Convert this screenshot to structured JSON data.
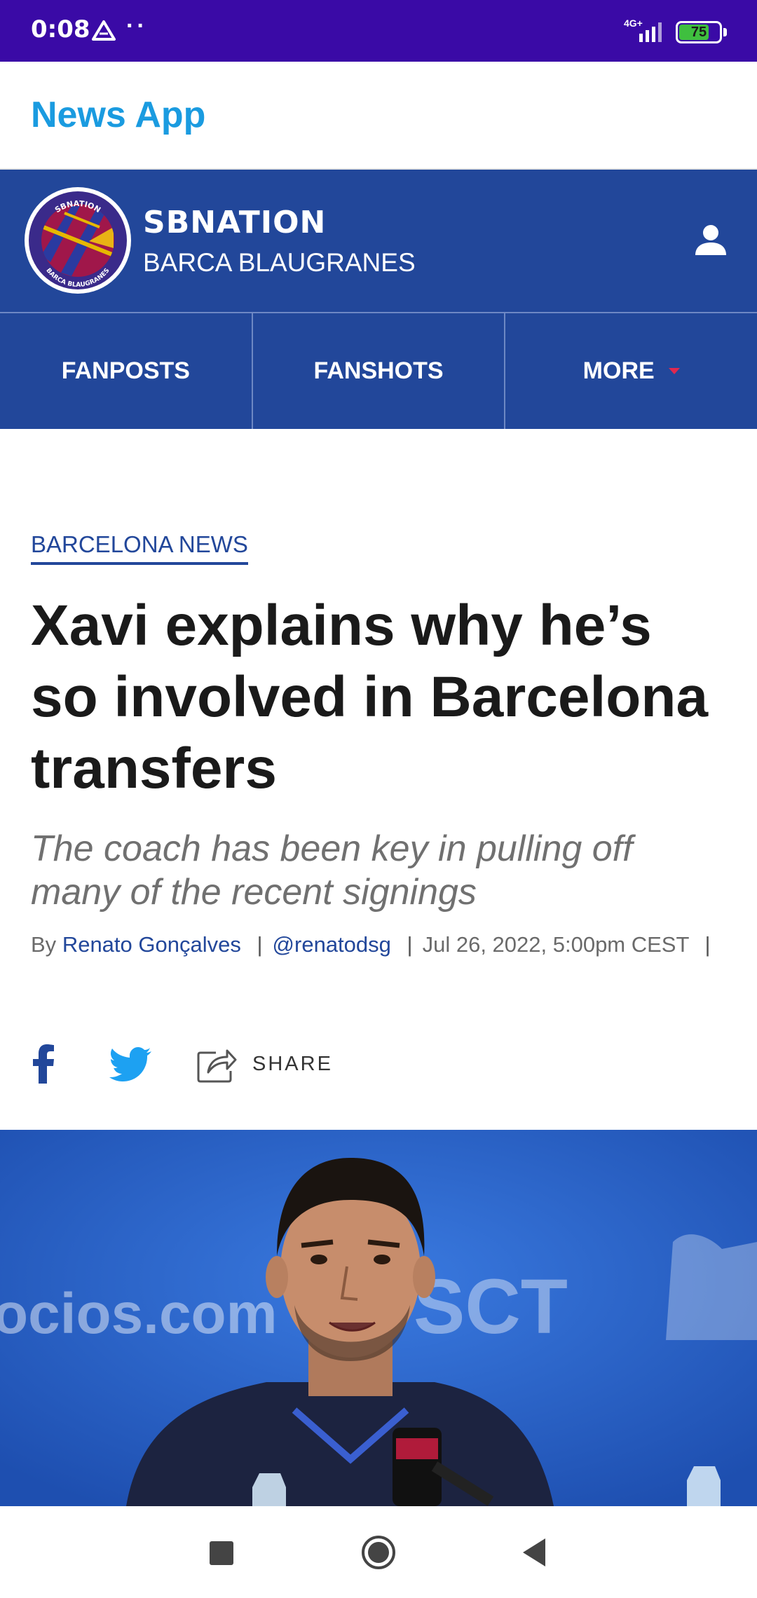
{
  "status_bar": {
    "time": "0:08",
    "network": "4G+",
    "battery": "75",
    "battery_level_percent": 75
  },
  "app_bar": {
    "title": "News App"
  },
  "site_header": {
    "brand": "SBNATION",
    "subbrand": "BARCA BLAUGRANES",
    "logo_text_top": "SBNATION",
    "logo_text_bottom": "BARCA BLAUGRANES"
  },
  "nav": {
    "items": [
      {
        "label": "FANPOSTS"
      },
      {
        "label": "FANSHOTS"
      },
      {
        "label": "MORE"
      }
    ]
  },
  "article": {
    "category": "BARCELONA NEWS",
    "headline": "Xavi explains why he’s so involved in Barcelona transfers",
    "dek": "The coach has been key in pulling off many of the recent signings",
    "byline_prefix": "By",
    "author": "Renato Gonçalves",
    "handle": "@renatodsg",
    "date": "Jul 26, 2022, 5:00pm CEST",
    "separator": "|"
  },
  "share": {
    "label": "SHARE"
  },
  "hero": {
    "background_text_left": "ocios.com",
    "background_text_mid": "SCT"
  },
  "colors": {
    "status_bar": "#3a0aa6",
    "app_title": "#1a9be0",
    "site_blue": "#22479a",
    "caret": "#e0284f",
    "twitter": "#1da1f2"
  }
}
